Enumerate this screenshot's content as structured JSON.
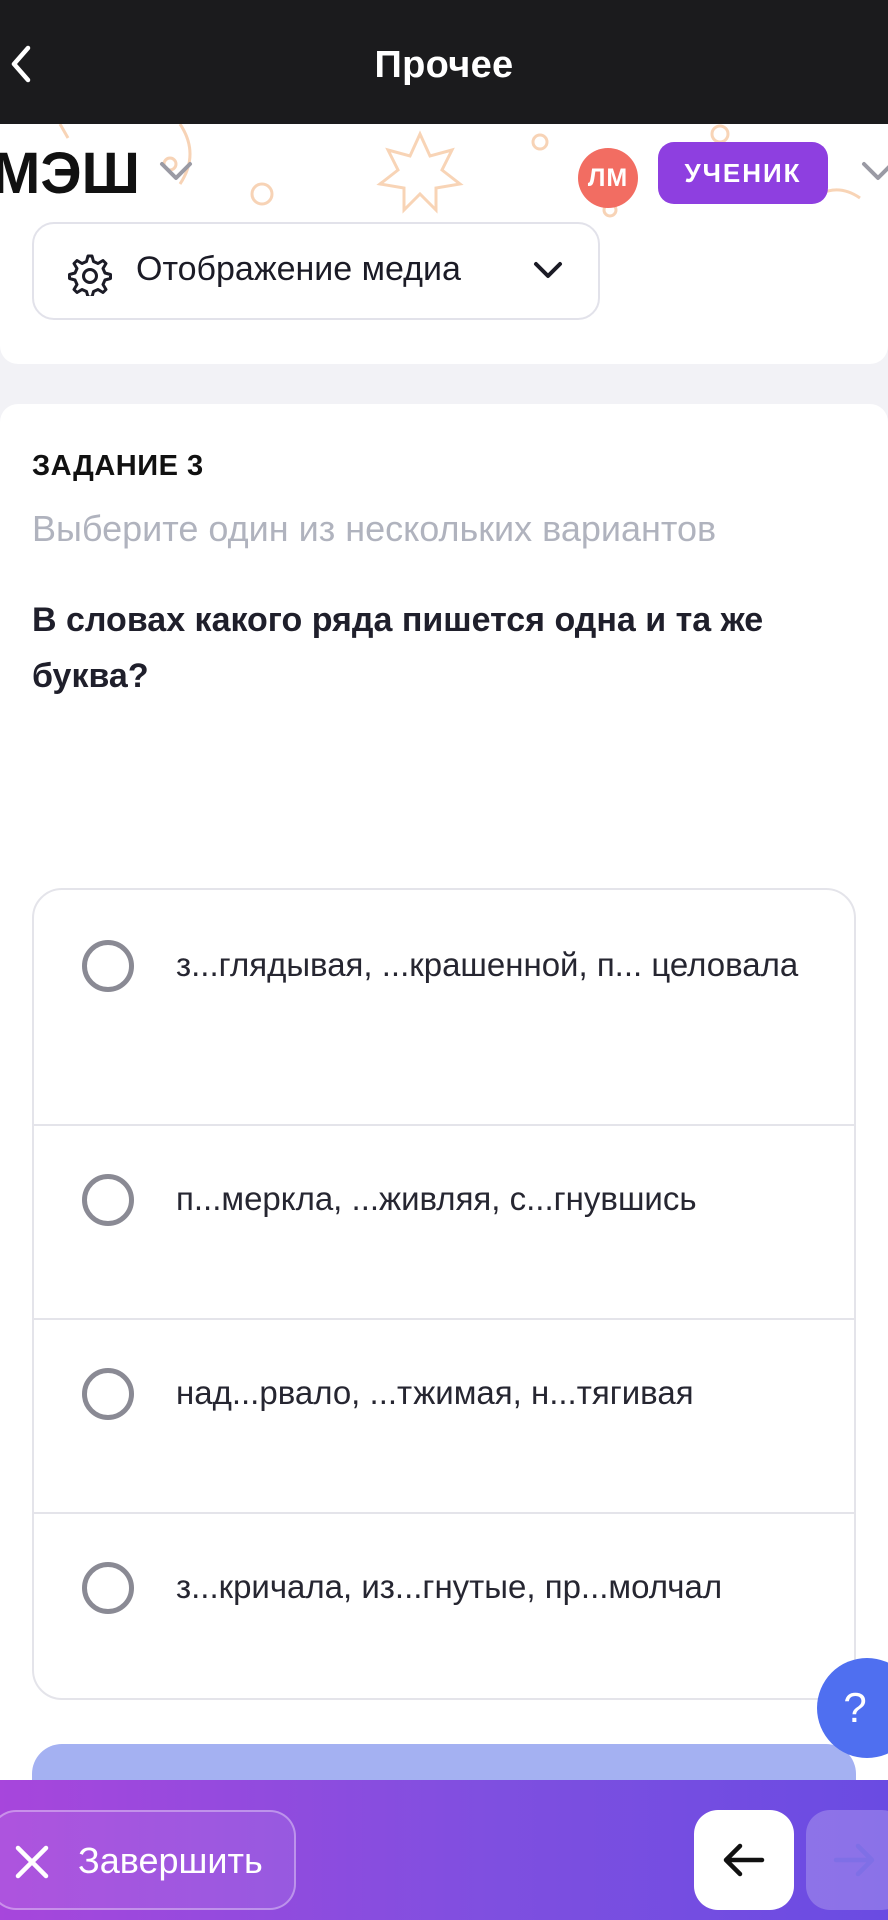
{
  "topbar": {
    "title": "Прочее",
    "back_icon": "chevron-left-icon"
  },
  "header": {
    "logo": "МЭШ",
    "avatar_initials": "ЛМ",
    "role": "УЧЕНИК"
  },
  "media": {
    "label": "Отображение медиа",
    "icon": "gear-icon"
  },
  "task": {
    "number": "ЗАДАНИЕ 3",
    "hint": "Выберите один из нескольких вариантов",
    "question": "В словах какого ряда пишется одна и та же буква?",
    "options": [
      {
        "text": "з...глядывая, ...крашенной, п... целовала",
        "selected": false
      },
      {
        "text": "п...меркла, ...живляя, с...гнувшись",
        "selected": false
      },
      {
        "text": "над...рвало, ...тжимая, н...тягивая",
        "selected": false
      },
      {
        "text": "з...кричала, из...гнутые, пр...молчал",
        "selected": false
      }
    ]
  },
  "help": {
    "label": "?"
  },
  "bottom": {
    "finish_label": "Завершить"
  },
  "colors": {
    "accent": "#8e3fe0",
    "avatar": "#f26d62",
    "help": "#4f6ff0"
  }
}
